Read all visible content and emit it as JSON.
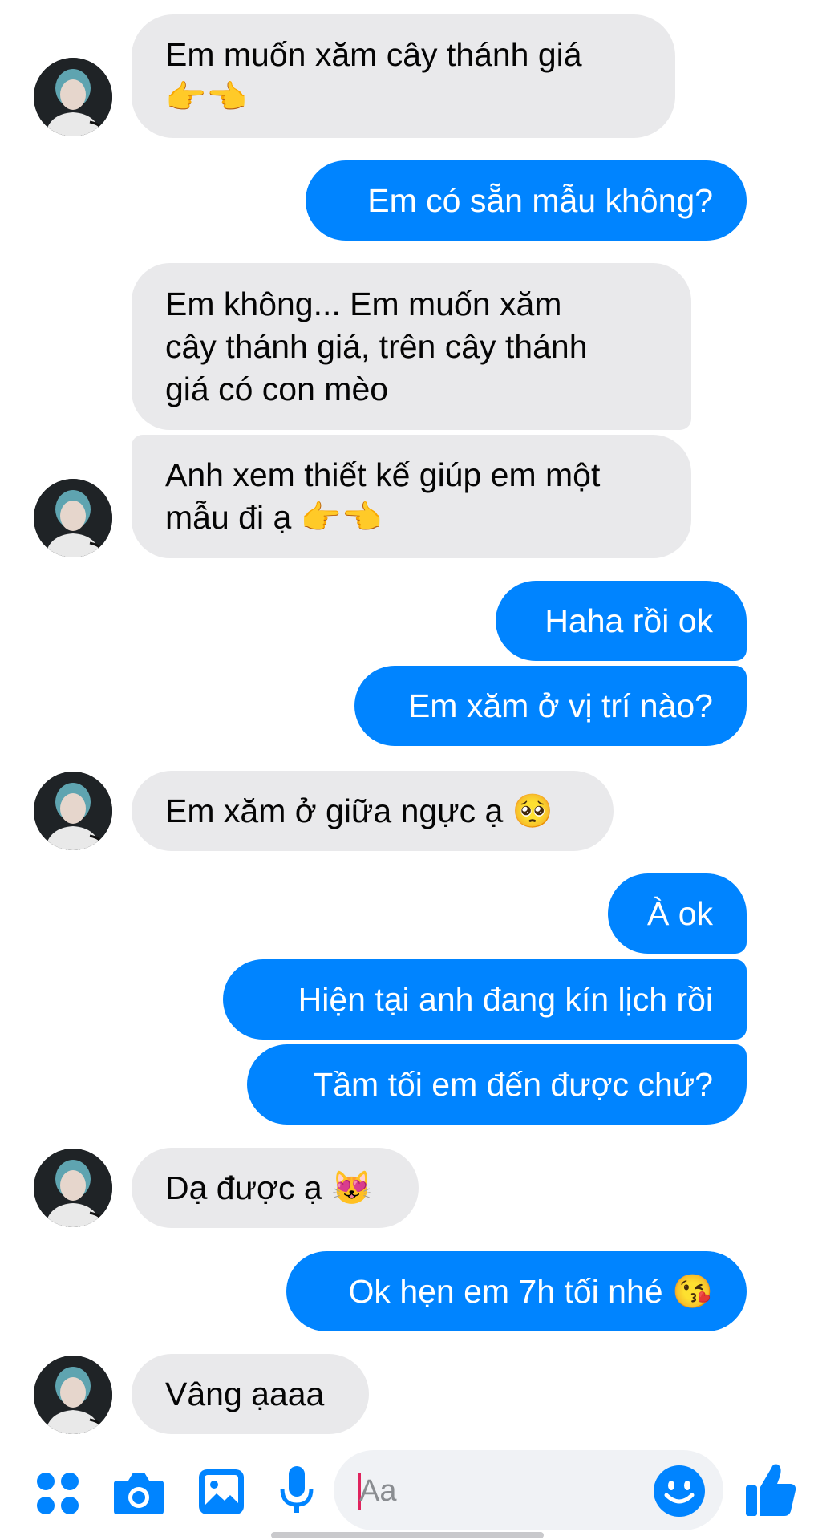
{
  "messages": [
    {
      "side": "in",
      "text": "Em muốn xăm cây thánh giá\n👉👈"
    },
    {
      "side": "out",
      "text": "Em có sẵn mẫu không?"
    },
    {
      "side": "in",
      "text": "Em không... Em muốn xăm\ncây thánh giá, trên cây thánh\ngiá có con mèo"
    },
    {
      "side": "in",
      "text": "Anh xem thiết kế giúp em một\nmẫu đi ạ 👉👈"
    },
    {
      "side": "out",
      "text": "Haha rồi ok"
    },
    {
      "side": "out",
      "text": "Em xăm ở vị trí nào?"
    },
    {
      "side": "in",
      "text": "Em xăm ở giữa ngực ạ 🥺"
    },
    {
      "side": "out",
      "text": "À ok"
    },
    {
      "side": "out",
      "text": "Hiện tại anh đang kín lịch rồi"
    },
    {
      "side": "out",
      "text": "Tầm tối em đến được chứ?"
    },
    {
      "side": "in",
      "text": "Dạ được ạ 😻"
    },
    {
      "side": "out",
      "text": "Ok hẹn em 7h tối nhé 😘"
    },
    {
      "side": "in",
      "text": "Vâng ạaaa"
    }
  ],
  "composer": {
    "placeholder": "Aa",
    "icons": [
      "menu-dots-icon",
      "camera-icon",
      "image-icon",
      "microphone-icon",
      "emoji-icon",
      "thumbs-up-icon"
    ]
  },
  "colors": {
    "accent": "#0084ff",
    "incoming": "#e9e9eb"
  }
}
